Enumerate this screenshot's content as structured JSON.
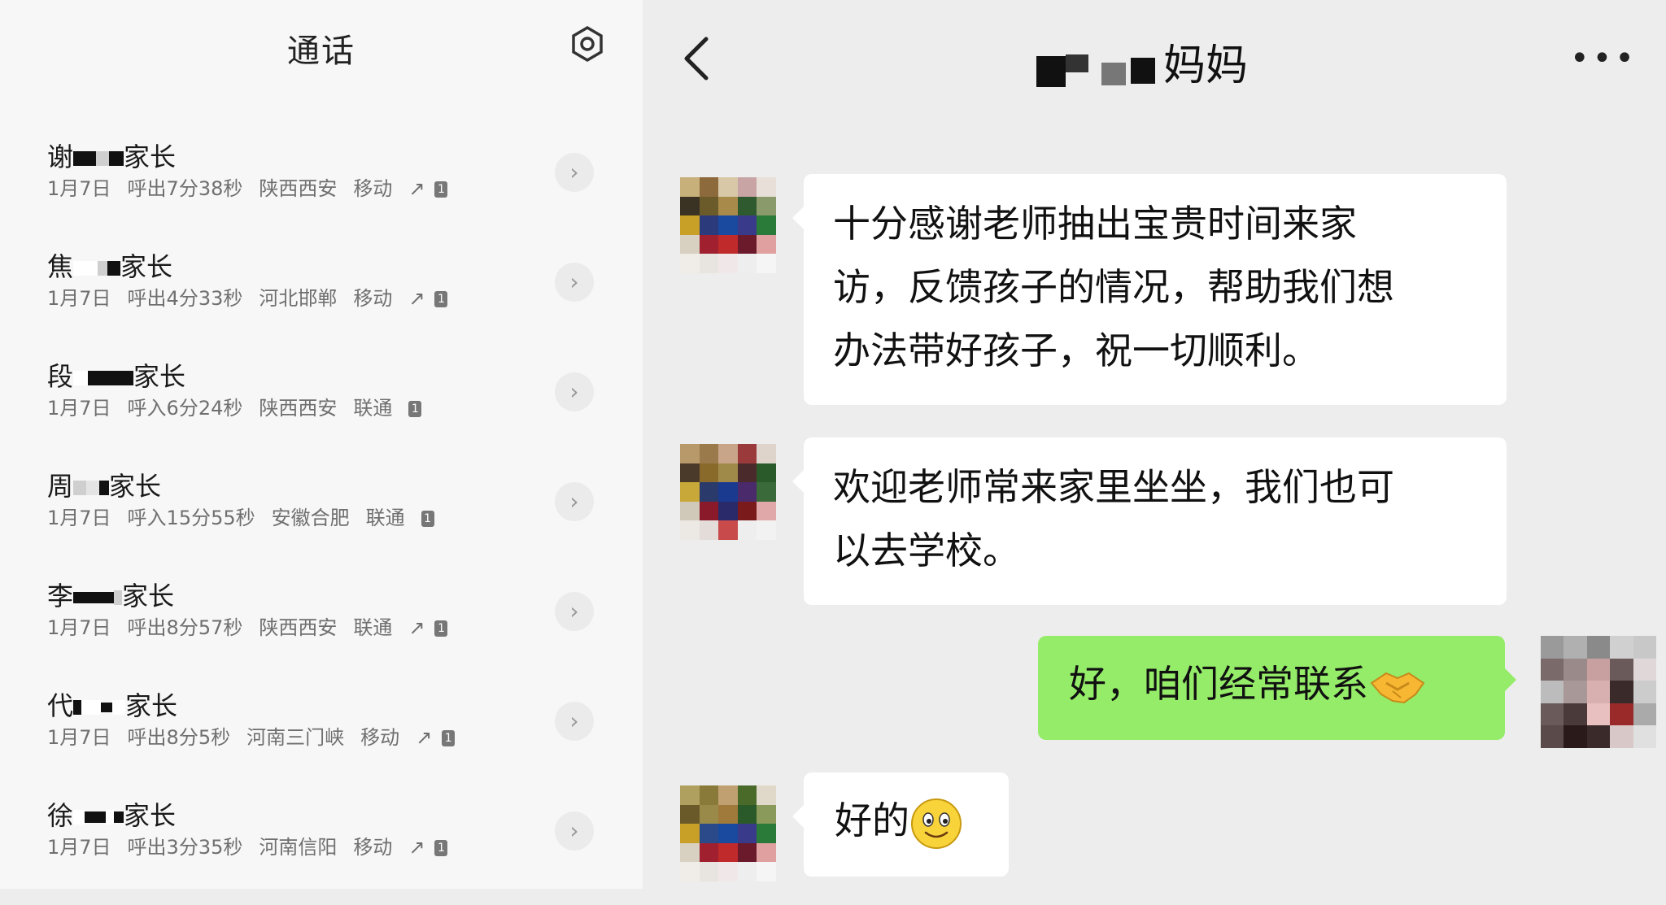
{
  "calls_panel": {
    "title": "通话",
    "settings_icon": "settings-icon",
    "rows": [
      {
        "name": "谢",
        "name_suffix": "家长",
        "date": "1月7日",
        "detail": "呼出7分38秒",
        "location": "陕西西安",
        "carrier": "移动",
        "outgoing": true,
        "sim": "1"
      },
      {
        "name": "焦",
        "name_suffix": "家长",
        "date": "1月7日",
        "detail": "呼出4分33秒",
        "location": "河北邯郸",
        "carrier": "移动",
        "outgoing": true,
        "sim": "1"
      },
      {
        "name": "段",
        "name_suffix": "家长",
        "date": "1月7日",
        "detail": "呼入6分24秒",
        "location": "陕西西安",
        "carrier": "联通",
        "outgoing": false,
        "sim": "1"
      },
      {
        "name": "周",
        "name_suffix": "家长",
        "date": "1月7日",
        "detail": "呼入15分55秒",
        "location": "安徽合肥",
        "carrier": "联通",
        "outgoing": false,
        "sim": "1"
      },
      {
        "name": "李",
        "name_suffix": "家长",
        "date": "1月7日",
        "detail": "呼出8分57秒",
        "location": "陕西西安",
        "carrier": "联通",
        "outgoing": true,
        "sim": "1"
      },
      {
        "name": "代",
        "name_suffix": "家长",
        "date": "1月7日",
        "detail": "呼出8分5秒",
        "location": "河南三门峡",
        "carrier": "移动",
        "outgoing": true,
        "sim": "1"
      },
      {
        "name": "徐",
        "name_suffix": "家长",
        "date": "1月7日",
        "detail": "呼出3分35秒",
        "location": "河南信阳",
        "carrier": "移动",
        "outgoing": true,
        "sim": "1"
      }
    ]
  },
  "chat": {
    "title_suffix": "妈妈",
    "back_icon": "back-chevron-icon",
    "more_icon": "more-icon",
    "messages": [
      {
        "from": "them",
        "lines": [
          "十分感谢老师抽出宝贵时间来家",
          "访，反馈孩子的情况，帮助我们想",
          "办法带好孩子，祝一切顺利。"
        ]
      },
      {
        "from": "them",
        "lines": [
          "欢迎老师常来家里坐坐，我们也可",
          "以去学校。"
        ]
      },
      {
        "from": "me",
        "text": "好，咱们经常联系",
        "emoji": "handshake-emoji"
      },
      {
        "from": "them",
        "text": "好的",
        "emoji": "smile-emoji"
      }
    ]
  },
  "colors": {
    "self_bubble": "#95ec69",
    "other_bubble": "#ffffff",
    "chat_bg": "#ededed",
    "list_bg": "#f7f7f7"
  }
}
